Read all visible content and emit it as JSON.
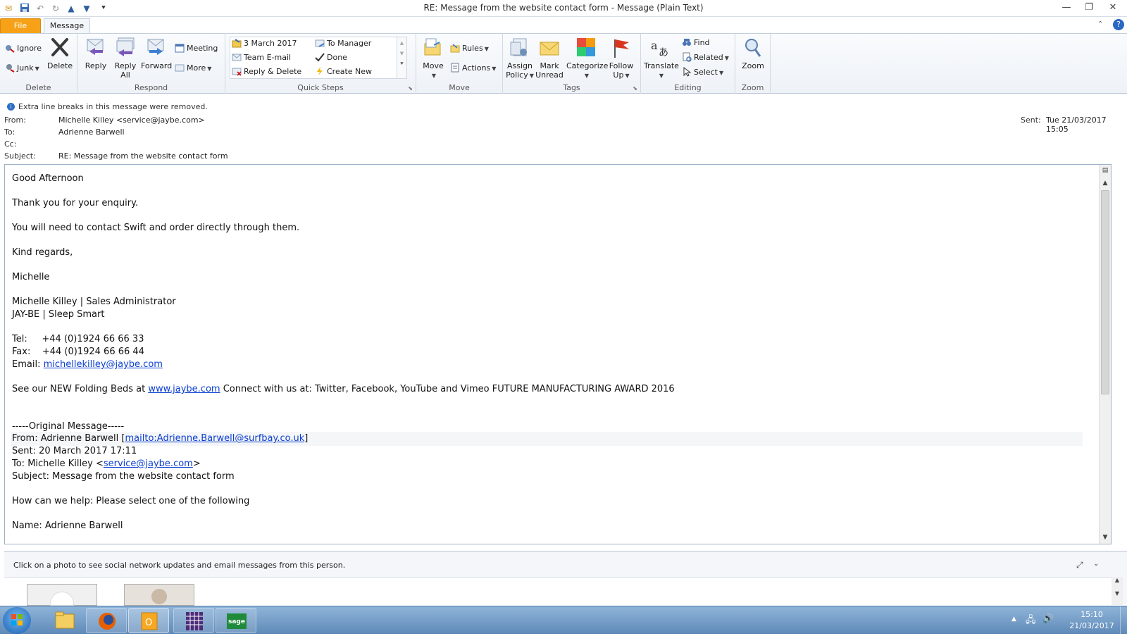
{
  "window": {
    "title": "RE: Message from the website contact form  -  Message (Plain Text)"
  },
  "tabs": [
    "File",
    "Message"
  ],
  "ribbon": {
    "delete_group": {
      "label": "Delete",
      "ignore": "Ignore",
      "junk": "Junk",
      "delete": "Delete"
    },
    "respond_group": {
      "label": "Respond",
      "reply": "Reply",
      "reply_all_1": "Reply",
      "reply_all_2": "All",
      "forward": "Forward",
      "meeting": "Meeting",
      "more": "More"
    },
    "quick_steps_group": {
      "label": "Quick Steps",
      "items": [
        "3 March 2017",
        "To Manager",
        "Team E-mail",
        "Done",
        "Reply & Delete",
        "Create New"
      ]
    },
    "move_group": {
      "label": "Move",
      "move": "Move",
      "rules": "Rules",
      "actions": "Actions"
    },
    "tags_group": {
      "label": "Tags",
      "assign_1": "Assign",
      "assign_2": "Policy",
      "mark_1": "Mark",
      "mark_2": "Unread",
      "categorize": "Categorize",
      "follow_1": "Follow",
      "follow_2": "Up"
    },
    "editing_group": {
      "label": "Editing",
      "translate": "Translate",
      "find": "Find",
      "related": "Related",
      "select": "Select"
    },
    "zoom_group": {
      "label": "Zoom",
      "zoom": "Zoom"
    }
  },
  "infobar": {
    "text": "Extra line breaks in this message were removed."
  },
  "headers": {
    "from_label": "From:",
    "from_value": "Michelle Killey <service@jaybe.com>",
    "to_label": "To:",
    "to_value": "Adrienne Barwell",
    "cc_label": "Cc:",
    "cc_value": "",
    "subject_label": "Subject:",
    "subject_value": "RE: Message from the website contact form",
    "sent_label": "Sent:",
    "sent_value": "Tue 21/03/2017 15:05"
  },
  "body": {
    "greeting": "Good Afternoon",
    "line1": "Thank you for your enquiry.",
    "line2": "You will need to contact Swift and order directly through them.",
    "regards": "Kind regards,",
    "name": "Michelle",
    "sig_name": "Michelle Killey  | Sales Administrator",
    "sig_company": "JAY-BE | Sleep Smart",
    "tel": "Tel:     +44 (0)1924 66 66 33",
    "fax": "Fax:    +44 (0)1924 66 66 44",
    "email_label": "Email: ",
    "email_link": "michellekilley@jaybe.com",
    "promo_a": "See our NEW Folding Beds at ",
    "promo_link": "www.jaybe.com",
    "promo_b": " Connect with us at: Twitter, Facebook, YouTube and Vimeo FUTURE MANUFACTURING AWARD 2016",
    "orig_header": "-----Original Message-----",
    "orig_from_a": "From: Adrienne Barwell [",
    "orig_from_link": "mailto:Adrienne.Barwell@surfbay.co.uk",
    "orig_from_b": "]",
    "orig_sent": "Sent: 20 March 2017 17:11",
    "orig_to_a": "To: Michelle Killey <",
    "orig_to_link": "service@jaybe.com",
    "orig_to_b": ">",
    "orig_subject": "Subject: Message from the website contact form",
    "orig_help": "How can we help: Please select one of the following",
    "orig_name": "Name: Adrienne Barwell"
  },
  "people_pane": {
    "text": "Click on a photo to see social network updates and email messages from this person."
  },
  "taskbar": {
    "time": "15:10",
    "date": "21/03/2017"
  }
}
